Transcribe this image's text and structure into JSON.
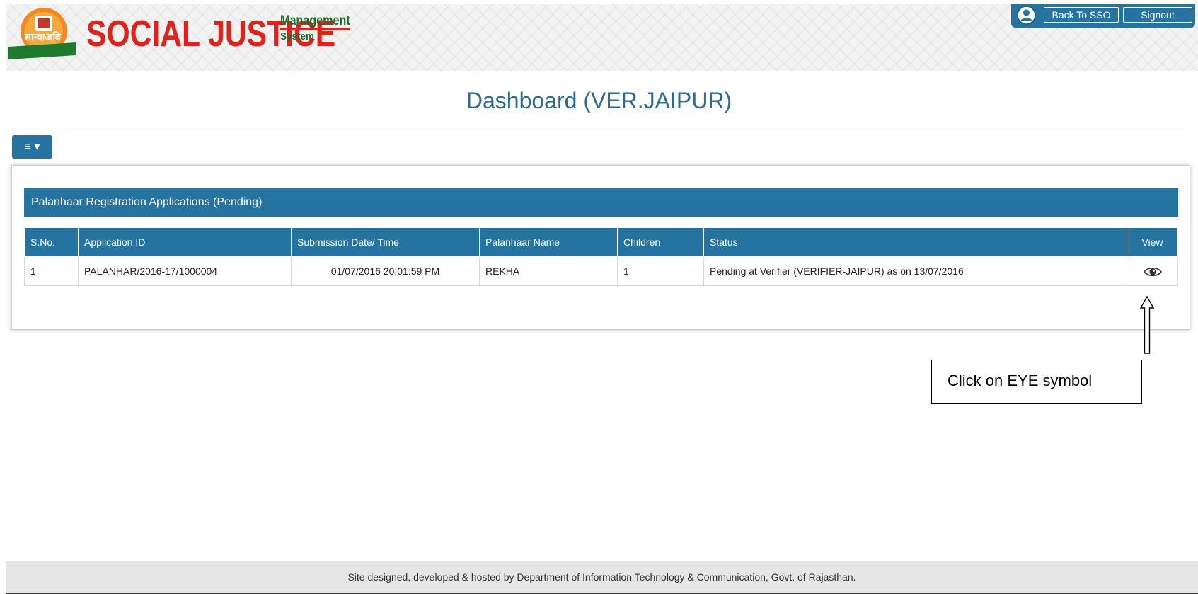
{
  "header": {
    "brand_main": "SOCIAL JUSTICE",
    "brand_sub1": "Management",
    "brand_sub2": "System",
    "emblem_text": "सान्याअवि"
  },
  "topbar": {
    "back_to_sso": "Back To SSO",
    "signout": "Signout"
  },
  "page_title": "Dashboard (VER.JAIPUR)",
  "menu_button": "≡ ▾",
  "panel": {
    "title": "Palanhaar Registration Applications (Pending)",
    "columns": [
      "S.No.",
      "Application ID",
      "Submission Date/ Time",
      "Palanhaar Name",
      "Children",
      "Status",
      "View"
    ],
    "rows": [
      {
        "sno": "1",
        "application_id": "PALANHAR/2016-17/1000004",
        "submission": "01/07/2016 20:01:59 PM",
        "name": "REKHA",
        "children": "1",
        "status": "Pending at Verifier (VERIFIER-JAIPUR) as on 13/07/2016",
        "view_icon": "eye-icon"
      }
    ]
  },
  "callout": "Click on EYE symbol",
  "footer": "Site designed, developed & hosted by Department of Information Technology & Communication, Govt. of Rajasthan.",
  "colors": {
    "primary": "#2573a0",
    "title": "#2d6a8e",
    "brand_red": "#e0231a",
    "brand_green": "#1d6b2e"
  }
}
